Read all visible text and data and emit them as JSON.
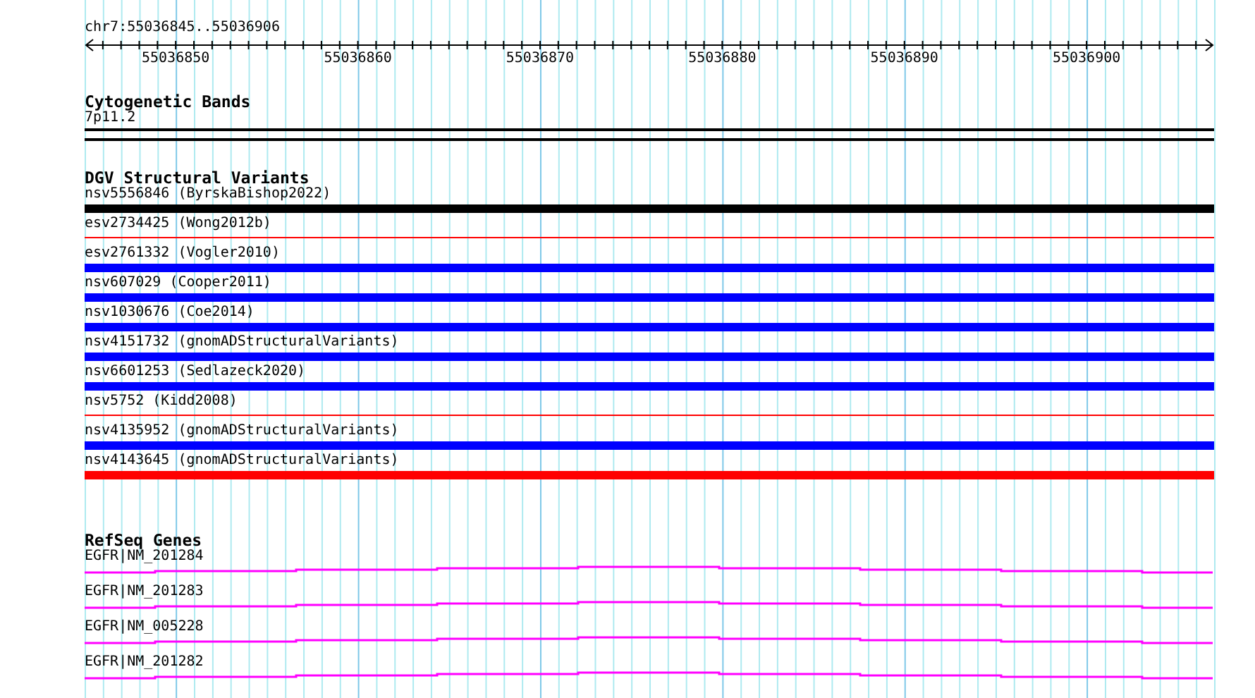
{
  "position": "chr7:55036845..55036906",
  "ruler": {
    "tick_labels": [
      "55036850",
      "55036860",
      "55036870",
      "55036880",
      "55036890",
      "55036900"
    ]
  },
  "tracks": [
    {
      "kind": "cytoband",
      "title": "Cytogenetic Bands",
      "items": [
        {
          "label": "7p11.2"
        }
      ]
    },
    {
      "kind": "variants",
      "title": "DGV Structural Variants",
      "items": [
        {
          "label": "nsv5556846 (ByrskaBishop2022)",
          "color": "#000000",
          "kind": "thick"
        },
        {
          "label": "esv2734425 (Wong2012b)",
          "color": "#ff0000",
          "kind": "thin"
        },
        {
          "label": "esv2761332 (Vogler2010)",
          "color": "#0000ff",
          "kind": "thick"
        },
        {
          "label": "nsv607029 (Cooper2011)",
          "color": "#0000ff",
          "kind": "thick"
        },
        {
          "label": "nsv1030676 (Coe2014)",
          "color": "#0000ff",
          "kind": "thick"
        },
        {
          "label": "nsv4151732 (gnomADStructuralVariants)",
          "color": "#0000ff",
          "kind": "thick"
        },
        {
          "label": "nsv6601253 (Sedlazeck2020)",
          "color": "#0000ff",
          "kind": "thick"
        },
        {
          "label": "nsv5752 (Kidd2008)",
          "color": "#ff0000",
          "kind": "thin"
        },
        {
          "label": "nsv4135952 (gnomADStructuralVariants)",
          "color": "#0000ff",
          "kind": "thick"
        },
        {
          "label": "nsv4143645 (gnomADStructuralVariants)",
          "color": "#ff0000",
          "kind": "thick"
        }
      ]
    },
    {
      "kind": "genes",
      "title": "RefSeq Genes",
      "items": [
        {
          "label": "EGFR|NM_201284"
        },
        {
          "label": "EGFR|NM_201283"
        },
        {
          "label": "EGFR|NM_005228"
        },
        {
          "label": "EGFR|NM_201282"
        }
      ]
    }
  ]
}
